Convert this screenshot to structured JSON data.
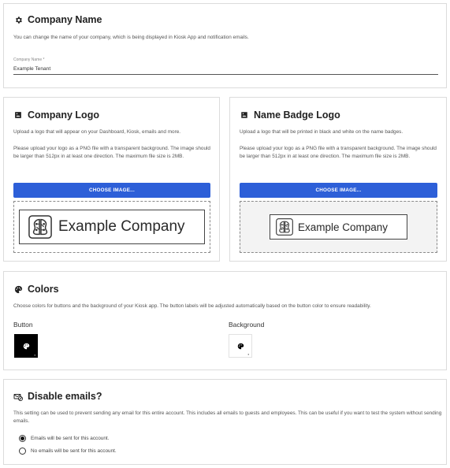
{
  "company_name": {
    "title": "Company Name",
    "description": "You can change the name of your company, which is being displayed in Kiosk App and notification emails.",
    "field_label": "Company Name *",
    "field_value": "Example Tenant",
    "icon": "gear-icon"
  },
  "company_logo": {
    "title": "Company Logo",
    "description": "Upload a logo that will appear on your Dashboard, Kiosk, emails and more.",
    "requirements": "Please upload your logo as a PNG file with a transparent background. The image should be larger than 512px in at least one direction. The maximum file size is 2MB.",
    "button_label": "CHOOSE IMAGE...",
    "preview_text": "Example Company",
    "icon": "image-icon"
  },
  "name_badge_logo": {
    "title": "Name Badge Logo",
    "description": "Upload a logo that will be printed in black and white on the name badges.",
    "requirements": "Please upload your logo as a PNG file with a transparent background. The image should be larger than 512px in at least one direction. The maximum file size is 2MB.",
    "button_label": "CHOOSE IMAGE...",
    "preview_text": "Example Company",
    "icon": "image-icon"
  },
  "colors": {
    "title": "Colors",
    "description": "Choose colors for buttons and the background of your Kiosk app. The button labels will be adjusted automatically based on the button color to ensure readability.",
    "button_label": "Button",
    "background_label": "Background",
    "button_color": "#000000",
    "background_color": "#ffffff",
    "icon": "palette-icon"
  },
  "disable_emails": {
    "title": "Disable emails?",
    "description": "This setting can be used to prevent sending any email for this entire account. This includes all emails to guests and employees. This can be useful if you want to test the system without sending emails.",
    "options": [
      {
        "label": "Emails will be sent for this account.",
        "selected": true
      },
      {
        "label": "No emails will be sent for this account.",
        "selected": false
      }
    ],
    "icon": "mail-off-icon"
  },
  "accent_color": "#2d5fd8"
}
